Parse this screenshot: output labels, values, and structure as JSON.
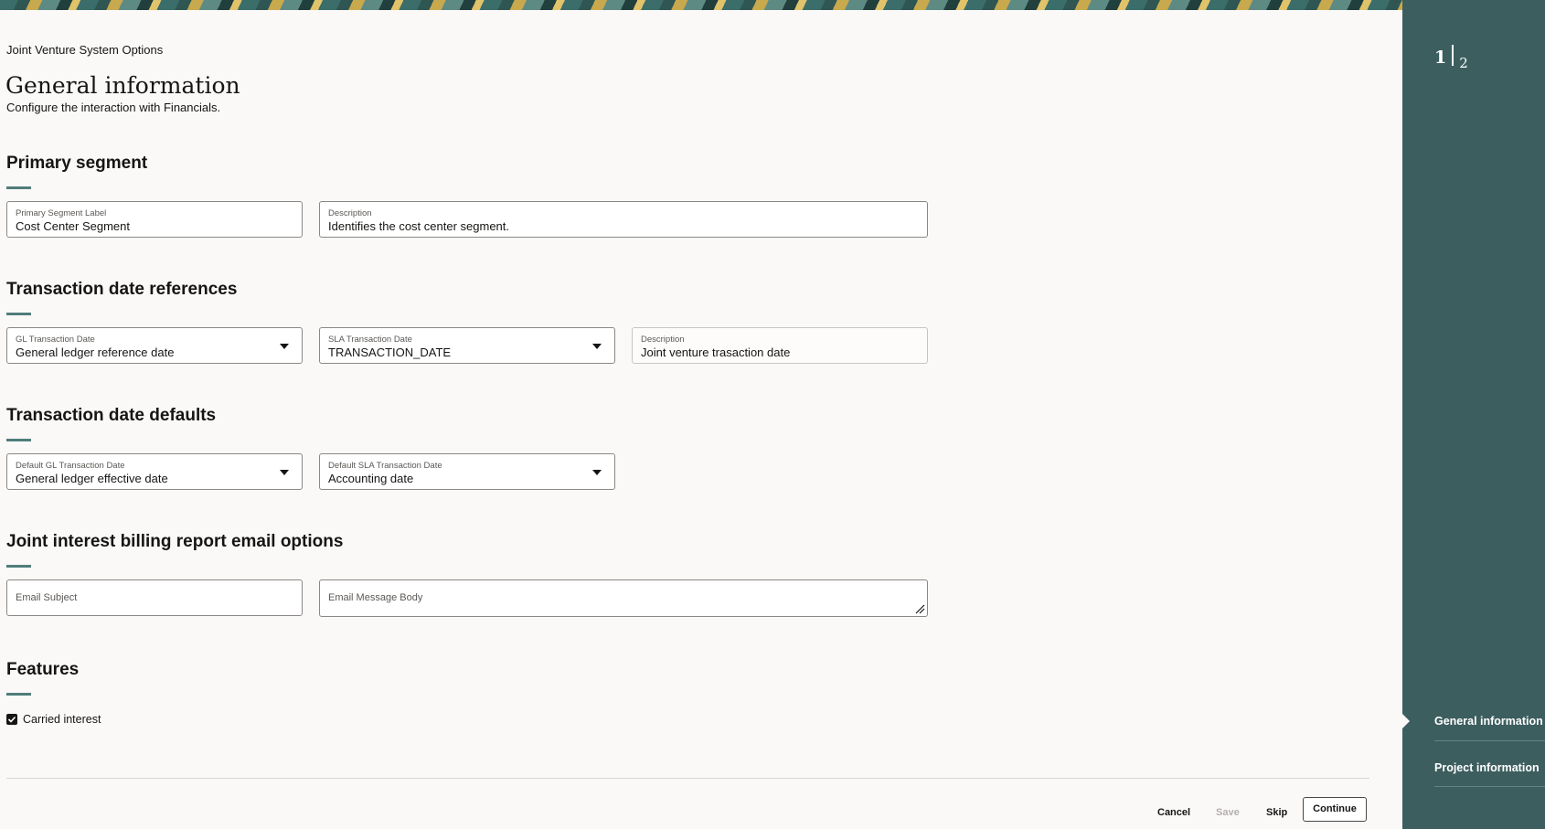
{
  "header": {
    "breadcrumb": "Joint Venture System Options",
    "title": "General information",
    "subtitle": "Configure the interaction with Financials."
  },
  "primary_segment": {
    "heading": "Primary segment",
    "label_field": {
      "label": "Primary Segment Label",
      "value": "Cost Center Segment"
    },
    "description_field": {
      "label": "Description",
      "value": "Identifies the cost center segment."
    }
  },
  "date_references": {
    "heading": "Transaction date references",
    "gl_date": {
      "label": "GL Transaction Date",
      "value": "General ledger reference date"
    },
    "sla_date": {
      "label": "SLA Transaction Date",
      "value": "TRANSACTION_DATE"
    },
    "description": {
      "label": "Description",
      "value": "Joint venture trasaction date"
    }
  },
  "date_defaults": {
    "heading": "Transaction date defaults",
    "default_gl": {
      "label": "Default GL Transaction Date",
      "value": "General ledger effective date"
    },
    "default_sla": {
      "label": "Default SLA Transaction Date",
      "value": "Accounting date"
    }
  },
  "email_options": {
    "heading": "Joint interest billing report email options",
    "subject_placeholder": "Email Subject",
    "body_placeholder": "Email Message Body"
  },
  "features": {
    "heading": "Features",
    "carried_interest": {
      "label": "Carried interest",
      "checked": true
    }
  },
  "footer": {
    "cancel": "Cancel",
    "save": "Save",
    "skip": "Skip",
    "continue": "Continue"
  },
  "sidebar": {
    "current_step": "1",
    "total_steps": "2",
    "steps": [
      {
        "label": "General information",
        "active": true
      },
      {
        "label": "Project information",
        "active": false
      }
    ]
  },
  "colors": {
    "sidebar_bg": "#3d5e5f",
    "accent_rule": "#4f7d7b",
    "page_bg": "#fbf9f8"
  }
}
